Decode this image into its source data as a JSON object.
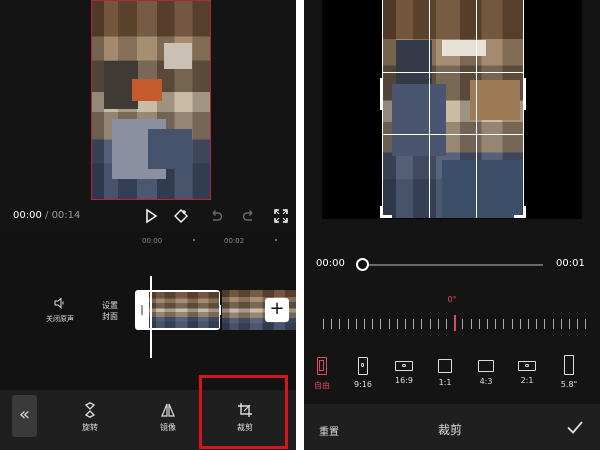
{
  "left": {
    "time_current": "00:00",
    "time_separator": " / ",
    "time_total": "00:14",
    "ruler": [
      "00:00",
      "00:02"
    ],
    "mute_label": "关闭原声",
    "cover_label": "设置\n封面",
    "tools": {
      "collapse": "«",
      "rotate": "旋转",
      "mirror": "镜像",
      "crop": "裁剪"
    },
    "add_label": "+"
  },
  "right": {
    "progress_start": "00:00",
    "progress_end": "00:01",
    "angle": "0°",
    "ratios": [
      "自由",
      "9:16",
      "16:9",
      "1:1",
      "4:3",
      "2:1",
      "5.8\""
    ],
    "reset_label": "重置",
    "title": "裁剪"
  },
  "colors": {
    "accent": "#e0475e",
    "highlight": "#d7131c"
  }
}
